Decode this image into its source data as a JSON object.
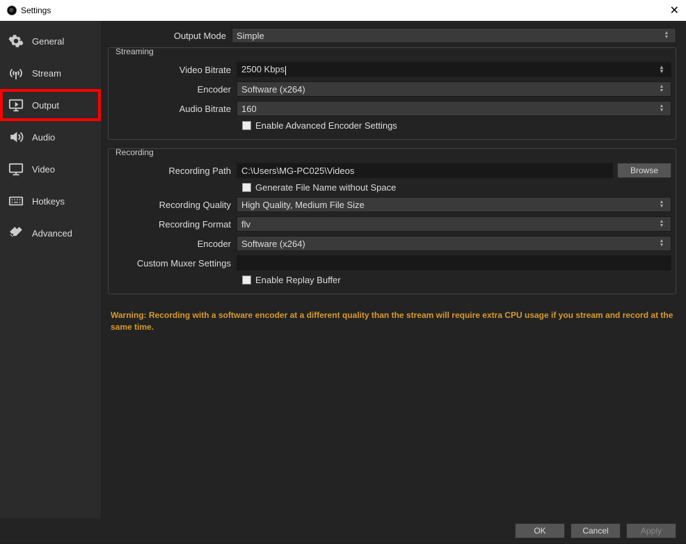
{
  "window": {
    "title": "Settings"
  },
  "sidebar": {
    "items": [
      {
        "label": "General"
      },
      {
        "label": "Stream"
      },
      {
        "label": "Output"
      },
      {
        "label": "Audio"
      },
      {
        "label": "Video"
      },
      {
        "label": "Hotkeys"
      },
      {
        "label": "Advanced"
      }
    ]
  },
  "output_mode": {
    "label": "Output Mode",
    "value": "Simple"
  },
  "streaming": {
    "legend": "Streaming",
    "video_bitrate": {
      "label": "Video Bitrate",
      "value": "2500 Kbps"
    },
    "encoder": {
      "label": "Encoder",
      "value": "Software (x264)"
    },
    "audio_bitrate": {
      "label": "Audio Bitrate",
      "value": "160"
    },
    "advanced_checkbox": {
      "label": "Enable Advanced Encoder Settings"
    }
  },
  "recording": {
    "legend": "Recording",
    "path": {
      "label": "Recording Path",
      "value": "C:\\Users\\MG-PC025\\Videos",
      "browse": "Browse"
    },
    "gen_filename": {
      "label": "Generate File Name without Space"
    },
    "quality": {
      "label": "Recording Quality",
      "value": "High Quality, Medium File Size"
    },
    "format": {
      "label": "Recording Format",
      "value": "flv"
    },
    "encoder": {
      "label": "Encoder",
      "value": "Software (x264)"
    },
    "muxer": {
      "label": "Custom Muxer Settings",
      "value": ""
    },
    "replay_buffer": {
      "label": "Enable Replay Buffer"
    }
  },
  "warning": "Warning: Recording with a software encoder at a different quality than the stream will require extra CPU usage if you stream and record at the same time.",
  "footer": {
    "ok": "OK",
    "cancel": "Cancel",
    "apply": "Apply"
  }
}
